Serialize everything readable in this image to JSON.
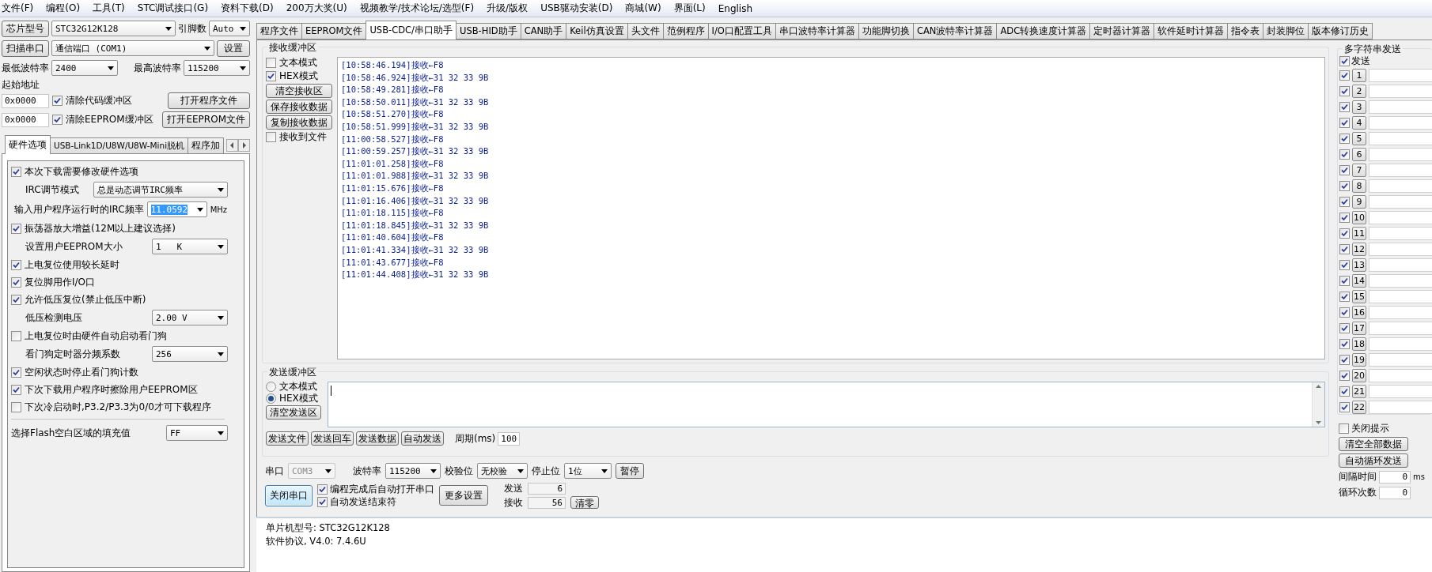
{
  "menu": [
    "文件(F)",
    "编程(O)",
    "工具(T)",
    "STC调试接口(G)",
    "资料下载(D)",
    "200万大奖(U)",
    "视频教学/技术论坛/选型(F)",
    "升级/版权",
    "USB驱动安装(D)",
    "商城(W)",
    "界面(L)",
    "English"
  ],
  "chip": {
    "label": "芯片型号",
    "value": "STC32G12K128",
    "pins_label": "引脚数",
    "pins_value": "Auto"
  },
  "port": {
    "scan": "扫描串口",
    "value": "通信端口 (COM1)",
    "settings": "设置"
  },
  "baud": {
    "min_label": "最低波特率",
    "min_value": "2400",
    "max_label": "最高波特率",
    "max_value": "115200"
  },
  "start_address": {
    "label": "起始地址",
    "rows": [
      {
        "value": "0x0000",
        "check_label": "清除代码缓冲区",
        "checked": true,
        "button": "打开程序文件"
      },
      {
        "value": "0x0000",
        "check_label": "清除EEPROM缓冲区",
        "checked": true,
        "button": "打开EEPROM文件"
      }
    ]
  },
  "left_tabs": [
    {
      "label": "硬件选项",
      "selected": true
    },
    {
      "label": "USB-Link1D/U8W/U8W-Mini脱机",
      "selected": false
    },
    {
      "label": "程序加",
      "selected": false
    }
  ],
  "hardware_options": [
    {
      "kind": "check",
      "label": "本次下载需要修改硬件选项",
      "checked": true
    },
    {
      "kind": "select",
      "label": "IRC调节模式",
      "value": "总是动态调节IRC频率"
    },
    {
      "kind": "freq",
      "label": "输入用户程序运行时的IRC频率",
      "value": "11.0592",
      "unit": "MHz"
    },
    {
      "kind": "check",
      "label": "振荡器放大增益(12M以上建议选择)",
      "checked": true
    },
    {
      "kind": "select",
      "label": "设置用户EEPROM大小",
      "value": "1   K"
    },
    {
      "kind": "check",
      "label": "上电复位使用较长延时",
      "checked": true
    },
    {
      "kind": "check",
      "label": "复位脚用作I/O口",
      "checked": true
    },
    {
      "kind": "check",
      "label": "允许低压复位(禁止低压中断)",
      "checked": true
    },
    {
      "kind": "select",
      "label": "低压检测电压",
      "value": "2.00 V"
    },
    {
      "kind": "check",
      "label": "上电复位时由硬件自动启动看门狗",
      "checked": false
    },
    {
      "kind": "select",
      "label": "看门狗定时器分频系数",
      "value": "256"
    },
    {
      "kind": "check",
      "label": "空闲状态时停止看门狗计数",
      "checked": true
    },
    {
      "kind": "check",
      "label": "下次下载用户程序时擦除用户EEPROM区",
      "checked": true
    },
    {
      "kind": "check",
      "label": "下次冷启动时,P3.2/P3.3为0/0才可下载程序",
      "checked": false
    },
    {
      "kind": "divider"
    },
    {
      "kind": "fill",
      "label": "选择Flash空白区域的填充值",
      "value": "FF"
    }
  ],
  "tabs": [
    {
      "label": "程序文件",
      "selected": false
    },
    {
      "label": "EEPROM文件",
      "selected": false
    },
    {
      "label": "USB-CDC/串口助手",
      "selected": true
    },
    {
      "label": "USB-HID助手",
      "selected": false
    },
    {
      "label": "CAN助手",
      "selected": false
    },
    {
      "label": "Keil仿真设置",
      "selected": false
    },
    {
      "label": "头文件",
      "selected": false
    },
    {
      "label": "范例程序",
      "selected": false
    },
    {
      "label": "I/O口配置工具",
      "selected": false
    },
    {
      "label": "串口波特率计算器",
      "selected": false
    },
    {
      "label": "功能脚切换",
      "selected": false
    },
    {
      "label": "CAN波特率计算器",
      "selected": false
    },
    {
      "label": "ADC转换速度计算器",
      "selected": false
    },
    {
      "label": "定时器计算器",
      "selected": false
    },
    {
      "label": "软件延时计算器",
      "selected": false
    },
    {
      "label": "指令表",
      "selected": false
    },
    {
      "label": "封装脚位",
      "selected": false
    },
    {
      "label": "版本修订历史",
      "selected": false
    }
  ],
  "receive": {
    "title": "接收缓冲区",
    "controls": [
      {
        "kind": "check",
        "label": "文本模式",
        "checked": false
      },
      {
        "kind": "check",
        "label": "HEX模式",
        "checked": true
      },
      {
        "kind": "button",
        "label": "清空接收区"
      },
      {
        "kind": "button",
        "label": "保存接收数据"
      },
      {
        "kind": "button",
        "label": "复制接收数据"
      },
      {
        "kind": "check",
        "label": "接收到文件",
        "checked": false
      }
    ],
    "lines": [
      "[10:58:46.194]接收←F8",
      "[10:58:46.924]接收←31 32 33 9B",
      "[10:58:49.281]接收←F8",
      "[10:58:50.011]接收←31 32 33 9B",
      "[10:58:51.270]接收←F8",
      "[10:58:51.999]接收←31 32 33 9B",
      "[11:00:58.527]接收←F8",
      "[11:00:59.257]接收←31 32 33 9B",
      "[11:01:01.258]接收←F8",
      "[11:01:01.988]接收←31 32 33 9B",
      "[11:01:15.676]接收←F8",
      "[11:01:16.406]接收←31 32 33 9B",
      "[11:01:18.115]接收←F8",
      "[11:01:18.845]接收←31 32 33 9B",
      "[11:01:40.604]接收←F8",
      "[11:01:41.334]接收←31 32 33 9B",
      "[11:01:43.677]接收←F8",
      "[11:01:44.408]接收←31 32 33 9B"
    ]
  },
  "send": {
    "title": "发送缓冲区",
    "modes": [
      {
        "label": "文本模式",
        "selected": false
      },
      {
        "label": "HEX模式",
        "selected": true
      }
    ],
    "clear": "清空发送区",
    "buttons": [
      "发送文件",
      "发送回车",
      "发送数据",
      "自动发送"
    ],
    "period_label": "周期(ms)",
    "period_value": "100"
  },
  "serial": {
    "port_label": "串口",
    "port_value": "COM3",
    "port_disabled": true,
    "baud_label": "波特率",
    "baud_value": "115200",
    "parity_label": "校验位",
    "parity_value": "无校验",
    "stop_label": "停止位",
    "stop_value": "1位",
    "pause": "暂停",
    "close": "关闭串口",
    "options": [
      {
        "label": "编程完成后自动打开串口",
        "checked": true
      },
      {
        "label": "自动发送结束符",
        "checked": true
      }
    ],
    "more": "更多设置",
    "sent_label": "发送",
    "sent_value": "6",
    "recv_label": "接收",
    "recv_value": "56",
    "reset": "清零"
  },
  "log": [
    "单片机型号: STC32G12K128",
    "软件协议, V4.0: 7.4.6U"
  ],
  "multi": {
    "title": "多字符串发送",
    "send_label": "发送",
    "send_checked": true,
    "rows": [
      {
        "label": "1",
        "checked": true
      },
      {
        "label": "2",
        "checked": true
      },
      {
        "label": "3",
        "checked": true
      },
      {
        "label": "4",
        "checked": true
      },
      {
        "label": "5",
        "checked": true
      },
      {
        "label": "6",
        "checked": true
      },
      {
        "label": "7",
        "checked": true
      },
      {
        "label": "8",
        "checked": true
      },
      {
        "label": "9",
        "checked": true
      },
      {
        "label": "10",
        "checked": true
      },
      {
        "label": "11",
        "checked": true
      },
      {
        "label": "12",
        "checked": true
      },
      {
        "label": "13",
        "checked": true
      },
      {
        "label": "14",
        "checked": true
      },
      {
        "label": "15",
        "checked": true
      },
      {
        "label": "16",
        "checked": true
      },
      {
        "label": "17",
        "checked": true
      },
      {
        "label": "18",
        "checked": true
      },
      {
        "label": "19",
        "checked": true
      },
      {
        "label": "20",
        "checked": true
      },
      {
        "label": "21",
        "checked": true
      },
      {
        "label": "22",
        "checked": true
      }
    ],
    "close_tip": {
      "label": "关闭提示",
      "checked": false
    },
    "buttons": [
      "清空全部数据",
      "自动循环发送"
    ],
    "interval_label": "间隔时间",
    "interval_value": "0",
    "interval_unit": "ms",
    "loop_label": "循环次数",
    "loop_value": "0"
  }
}
